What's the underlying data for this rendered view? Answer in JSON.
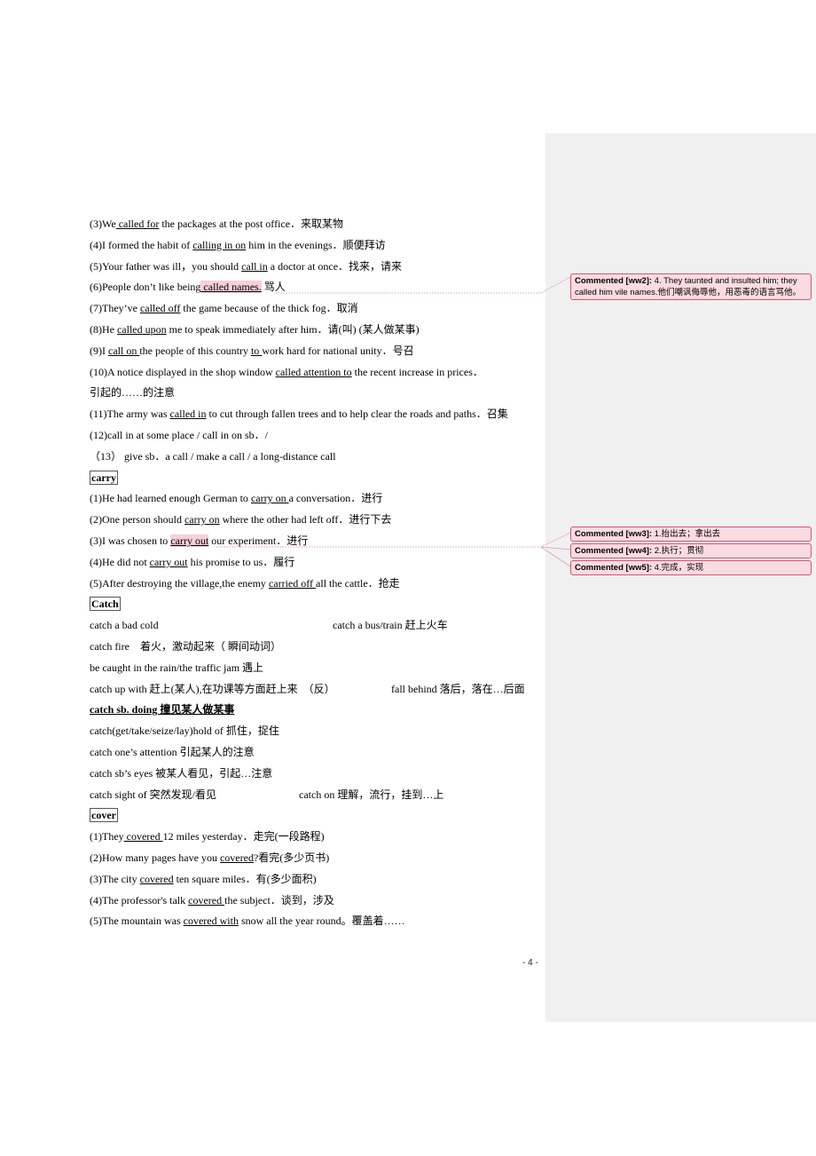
{
  "document": {
    "page_number": "- 4 -",
    "lines": [
      {
        "parts": [
          {
            "t": "(3)We"
          },
          {
            "t": " called for",
            "u": true
          },
          {
            "t": " the packages at the post office．来取某物"
          }
        ]
      },
      {
        "parts": [
          {
            "t": "(4)I formed the habit of "
          },
          {
            "t": "calling in on",
            "u": true
          },
          {
            "t": " him in the evenings．顺便拜访"
          }
        ]
      },
      {
        "parts": [
          {
            "t": "(5)Your father was ill，you should "
          },
          {
            "t": "call in",
            "u": true
          },
          {
            "t": " a doctor at once．找来，请来"
          }
        ]
      },
      {
        "parts": [
          {
            "t": "(6)People don’t like being"
          },
          {
            "t": " called names",
            "hl": true
          },
          {
            "t": ".",
            "hl": true
          },
          {
            "t": " 骂人"
          }
        ]
      },
      {
        "parts": [
          {
            "t": "(7)They’ve "
          },
          {
            "t": "called off",
            "u": true
          },
          {
            "t": " the game because of the thick fog．取消"
          }
        ]
      },
      {
        "parts": [
          {
            "t": "(8)He "
          },
          {
            "t": "called upon",
            "u": true
          },
          {
            "t": " me to speak immediately after him．请(叫) (某人做某事)"
          }
        ]
      },
      {
        "parts": [
          {
            "t": "(9)I "
          },
          {
            "t": "call on ",
            "u": true
          },
          {
            "t": "the people of this country "
          },
          {
            "t": "to ",
            "u": true
          },
          {
            "t": "work hard for national unity．号召"
          }
        ]
      },
      {
        "parts": [
          {
            "t": "(10)A notice displayed in the shop window "
          },
          {
            "t": "called attention to",
            "u": true
          },
          {
            "t": " the recent increase in prices．"
          }
        ]
      },
      {
        "parts": [
          {
            "t": "引起的……的注意"
          }
        ]
      },
      {
        "parts": [
          {
            "t": "(11)The army was "
          },
          {
            "t": "called in",
            "u": true
          },
          {
            "t": " to cut through fallen trees and to help clear the roads and paths．召集"
          }
        ]
      },
      {
        "parts": [
          {
            "t": "(12)call in at some place / call in on sb．/"
          }
        ]
      },
      {
        "parts": [
          {
            "t": "（13） give sb．a call / make a call / a long-distance call"
          }
        ]
      },
      {
        "heading": "carry"
      },
      {
        "parts": [
          {
            "t": "(1)He had learned enough German to "
          },
          {
            "t": "carry on ",
            "u": true
          },
          {
            "t": "a conversation．进行"
          }
        ]
      },
      {
        "parts": [
          {
            "t": "(2)One person should "
          },
          {
            "t": "carry on",
            "u": true
          },
          {
            "t": " where the other had left off．进行下去"
          }
        ]
      },
      {
        "parts": [
          {
            "t": "(3)I was chosen to "
          },
          {
            "t": "carry out",
            "hl": true
          },
          {
            "t": " our experiment．进行"
          }
        ]
      },
      {
        "parts": [
          {
            "t": "(4)He did not "
          },
          {
            "t": "carry out",
            "u": true
          },
          {
            "t": " his promise to us．履行"
          }
        ]
      },
      {
        "parts": [
          {
            "t": "(5)After destroying the village,the enemy "
          },
          {
            "t": "carried off ",
            "u": true
          },
          {
            "t": "all the cattle．抢走"
          }
        ]
      },
      {
        "heading": "Catch"
      },
      {
        "parts": [
          {
            "t": "catch a bad cold"
          }
        ],
        "col2": "catch a bus/train 赶上火车"
      },
      {
        "parts": [
          {
            "t": "catch fire　着火，激动起来（ 瞬间动词）"
          }
        ]
      },
      {
        "parts": [
          {
            "t": "be caught in the rain/the traffic jam 遇上"
          }
        ]
      },
      {
        "parts": [
          {
            "t": "catch up with  赶上(某人),在功课等方面赶上来　（反）"
          }
        ],
        "col2": "fall behind 落后，落在…后面",
        "col2_pos": "far"
      },
      {
        "parts": [
          {
            "t": "catch sb. doing 撞见某人做某事",
            "bu": true
          }
        ]
      },
      {
        "parts": [
          {
            "t": "catch(get/take/seize/lay)hold of 抓住，捉住"
          }
        ]
      },
      {
        "parts": [
          {
            "t": "catch one’s attention 引起某人的注意"
          }
        ]
      },
      {
        "parts": [
          {
            "t": "catch sb’s eyes 被某人看见，引起…注意"
          }
        ]
      },
      {
        "parts": [
          {
            "t": "catch sight of 突然发现/看见"
          }
        ],
        "col2": "catch on  理解，流行，挂到…上",
        "col2_pos": "mid"
      },
      {
        "heading": "cover"
      },
      {
        "parts": [
          {
            "t": "(1)They"
          },
          {
            "t": " covered ",
            "u": true
          },
          {
            "t": "12 miles yesterday．走完(一段路程)"
          }
        ]
      },
      {
        "parts": [
          {
            "t": "(2)How many pages have you "
          },
          {
            "t": "covered",
            "u": true
          },
          {
            "t": "?看完(多少页书)"
          }
        ]
      },
      {
        "parts": [
          {
            "t": "(3)The city "
          },
          {
            "t": "covered",
            "u": true
          },
          {
            "t": " ten square miles．有(多少面积)"
          }
        ]
      },
      {
        "parts": [
          {
            "t": "(4)The professor's talk "
          },
          {
            "t": "covered ",
            "u": true
          },
          {
            "t": "the subject．谈到，涉及"
          }
        ]
      },
      {
        "parts": [
          {
            "t": "(5)The mountain was "
          },
          {
            "t": "covered with",
            "u": true
          },
          {
            "t": " snow all the year round。覆盖着……"
          }
        ]
      }
    ]
  },
  "comments": [
    {
      "author": "Commented [ww2]:",
      "text": " 4.  They taunted and insulted him; they called him vile names.他们嘲讽侮辱他，用恶毒的语言骂他。"
    },
    {
      "author": "Commented [ww3]:",
      "text": " 1.抬出去；拿出去"
    },
    {
      "author": "Commented [ww4]:",
      "text": " 2.执行；贯彻"
    },
    {
      "author": "Commented [ww5]:",
      "text": " 4.完成，实现"
    }
  ],
  "colors": {
    "highlight": "#f7cfd8",
    "comment_border": "#d9546f",
    "comment_fill": "#fbdbe2",
    "margin_pane": "#f0f0f0"
  }
}
